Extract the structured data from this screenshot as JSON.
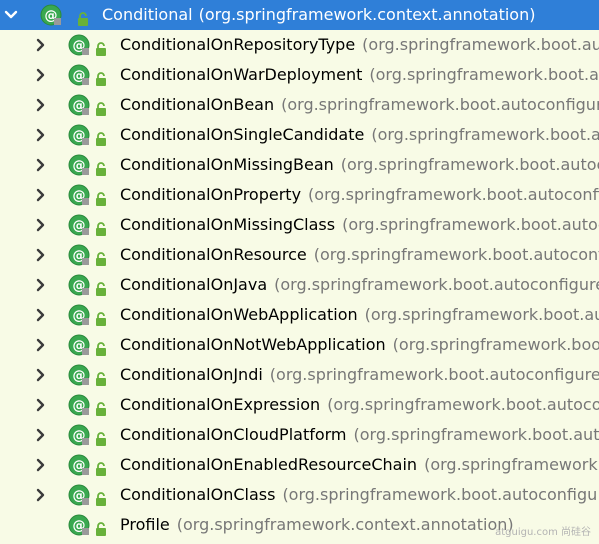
{
  "colors": {
    "background": "#f8fbe6",
    "selection": "#2f7fd8",
    "annotation_icon": "#39a84f",
    "lock_icon": "#68b13a",
    "package_text": "#777777"
  },
  "tree": {
    "root": {
      "name": "Conditional",
      "package": "(org.springframework.context.annotation)",
      "expanded": true,
      "selected": true,
      "icon": "annotation-icon"
    },
    "children": [
      {
        "name": "ConditionalOnRepositoryType",
        "package": "(org.springframework.boot.au",
        "expandable": true
      },
      {
        "name": "ConditionalOnWarDeployment",
        "package": "(org.springframework.boot.au",
        "expandable": true
      },
      {
        "name": "ConditionalOnBean",
        "package": "(org.springframework.boot.autoconfigure",
        "expandable": true
      },
      {
        "name": "ConditionalOnSingleCandidate",
        "package": "(org.springframework.boot.aut",
        "expandable": true
      },
      {
        "name": "ConditionalOnMissingBean",
        "package": "(org.springframework.boot.autoc",
        "expandable": true
      },
      {
        "name": "ConditionalOnProperty",
        "package": "(org.springframework.boot.autoconfig",
        "expandable": true
      },
      {
        "name": "ConditionalOnMissingClass",
        "package": "(org.springframework.boot.autoc",
        "expandable": true
      },
      {
        "name": "ConditionalOnResource",
        "package": "(org.springframework.boot.autoconf",
        "expandable": true
      },
      {
        "name": "ConditionalOnJava",
        "package": "(org.springframework.boot.autoconfigure",
        "expandable": true
      },
      {
        "name": "ConditionalOnWebApplication",
        "package": "(org.springframework.boot.aut",
        "expandable": true
      },
      {
        "name": "ConditionalOnNotWebApplication",
        "package": "(org.springframework.boot.",
        "expandable": true
      },
      {
        "name": "ConditionalOnJndi",
        "package": "(org.springframework.boot.autoconfigure.",
        "expandable": true
      },
      {
        "name": "ConditionalOnExpression",
        "package": "(org.springframework.boot.autocor",
        "expandable": true
      },
      {
        "name": "ConditionalOnCloudPlatform",
        "package": "(org.springframework.boot.auto",
        "expandable": true
      },
      {
        "name": "ConditionalOnEnabledResourceChain",
        "package": "(org.springframework",
        "expandable": true
      },
      {
        "name": "ConditionalOnClass",
        "package": "(org.springframework.boot.autoconfigu",
        "expandable": true
      },
      {
        "name": "Profile",
        "package": "(org.springframework.context.annotation)",
        "expandable": false
      }
    ]
  },
  "watermark": "atguigu.com 尚硅谷"
}
